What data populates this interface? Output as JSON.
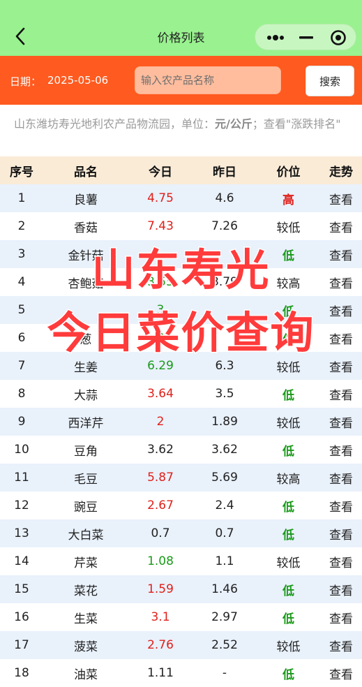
{
  "nav": {
    "title": "价格列表",
    "back_icon": "back-arrow-icon",
    "more_icon": "more-dots-icon",
    "minimize_icon": "minimize-icon",
    "close_icon": "target-close-icon"
  },
  "colors": {
    "navbar": "#99f28f",
    "searchbar": "#ff5a1f",
    "header_row": "#faebd7",
    "stripe": "#e9f1fb",
    "up": "#e0201a",
    "down": "#1a9a1a",
    "overlay": "#ff3b3b"
  },
  "search": {
    "date_label": "日期：",
    "date_value": "2025-05-06",
    "placeholder": "输入农产品名称",
    "button": "搜索"
  },
  "notice": {
    "text_1": "山东潍坊寿光地利农产品物流园，单位：",
    "unit": "元/公斤",
    "text_2": "；查看\"涨跌排名\""
  },
  "table": {
    "headers": [
      "序号",
      "品名",
      "今日",
      "昨日",
      "价位",
      "走势"
    ],
    "rows": [
      {
        "no": "1",
        "name": "良薯",
        "today": "4.75",
        "today_dir": "up",
        "yesterday": "4.6",
        "level": "高",
        "level_kind": "high",
        "trend": "查看"
      },
      {
        "no": "2",
        "name": "香菇",
        "today": "7.43",
        "today_dir": "up",
        "yesterday": "7.26",
        "level": "较低",
        "level_kind": "other",
        "trend": "查看"
      },
      {
        "no": "3",
        "name": "金针菇",
        "today": "",
        "today_dir": "down",
        "yesterday": "",
        "level": "低",
        "level_kind": "low",
        "trend": "查看"
      },
      {
        "no": "4",
        "name": "杏鲍菇",
        "today": "3.55",
        "today_dir": "down",
        "yesterday": "3.79",
        "level": "较高",
        "level_kind": "other",
        "trend": "查看"
      },
      {
        "no": "5",
        "name": "",
        "today": "3",
        "today_dir": "down",
        "yesterday": "",
        "level": "低",
        "level_kind": "low",
        "trend": "查看"
      },
      {
        "no": "6",
        "name": "葱",
        "today": "0",
        "today_dir": "down",
        "yesterday": "",
        "level": "低",
        "level_kind": "low",
        "trend": "查看"
      },
      {
        "no": "7",
        "name": "生姜",
        "today": "6.29",
        "today_dir": "down",
        "yesterday": "6.3",
        "level": "较低",
        "level_kind": "other",
        "trend": "查看"
      },
      {
        "no": "8",
        "name": "大蒜",
        "today": "3.64",
        "today_dir": "up",
        "yesterday": "3.5",
        "level": "低",
        "level_kind": "low",
        "trend": "查看"
      },
      {
        "no": "9",
        "name": "西洋芹",
        "today": "2",
        "today_dir": "up",
        "yesterday": "1.89",
        "level": "较低",
        "level_kind": "other",
        "trend": "查看"
      },
      {
        "no": "10",
        "name": "豆角",
        "today": "3.62",
        "today_dir": "same",
        "yesterday": "3.62",
        "level": "低",
        "level_kind": "low",
        "trend": "查看"
      },
      {
        "no": "11",
        "name": "毛豆",
        "today": "5.87",
        "today_dir": "up",
        "yesterday": "5.69",
        "level": "较高",
        "level_kind": "other",
        "trend": "查看"
      },
      {
        "no": "12",
        "name": "豌豆",
        "today": "2.67",
        "today_dir": "up",
        "yesterday": "2.4",
        "level": "低",
        "level_kind": "low",
        "trend": "查看"
      },
      {
        "no": "13",
        "name": "大白菜",
        "today": "0.7",
        "today_dir": "same",
        "yesterday": "0.7",
        "level": "低",
        "level_kind": "low",
        "trend": "查看"
      },
      {
        "no": "14",
        "name": "芹菜",
        "today": "1.08",
        "today_dir": "down",
        "yesterday": "1.1",
        "level": "较低",
        "level_kind": "other",
        "trend": "查看"
      },
      {
        "no": "15",
        "name": "菜花",
        "today": "1.59",
        "today_dir": "up",
        "yesterday": "1.46",
        "level": "低",
        "level_kind": "low",
        "trend": "查看"
      },
      {
        "no": "16",
        "name": "生菜",
        "today": "3.1",
        "today_dir": "up",
        "yesterday": "2.97",
        "level": "低",
        "level_kind": "low",
        "trend": "查看"
      },
      {
        "no": "17",
        "name": "菠菜",
        "today": "2.76",
        "today_dir": "up",
        "yesterday": "2.52",
        "level": "较低",
        "level_kind": "other",
        "trend": "查看"
      },
      {
        "no": "18",
        "name": "油菜",
        "today": "1.11",
        "today_dir": "same",
        "yesterday": "-",
        "level": "低",
        "level_kind": "low",
        "trend": "查看"
      }
    ]
  },
  "overlay": {
    "line_1": "山东寿光",
    "line_2": "今日菜价查询"
  }
}
